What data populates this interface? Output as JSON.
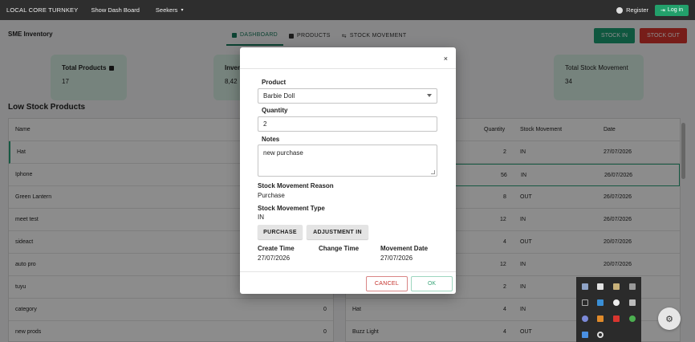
{
  "topbar": {
    "brand": "LOCAL CORE TURNKEY",
    "show_dash": "Show Dash Board",
    "seekers": "Seekers",
    "register": "Register",
    "login": "Log in"
  },
  "page": {
    "title": "SME Inventory",
    "tabs": [
      "DASHBOARD",
      "PRODUCTS",
      "STOCK MOVEMENT"
    ],
    "stock_in": "STOCK IN",
    "stock_out": "STOCK OUT",
    "cards": [
      {
        "label": "Total Products",
        "value": "17"
      },
      {
        "label": "Inven",
        "value": "8,42"
      },
      {
        "label": "Total Stock Movement",
        "value": "34"
      }
    ],
    "low_stock_title": "Low Stock Products",
    "left_table": {
      "header": "Name",
      "rows": [
        "Hat",
        "Iphone",
        "Green Lantern",
        "meet test",
        "sideact",
        "auto pro",
        "tuyu",
        "category",
        "new prods"
      ],
      "qty_tail": [
        "0",
        "0"
      ]
    },
    "right_table": {
      "headers": [
        "Quantity",
        "Stock Movement",
        "Date"
      ],
      "rows": [
        {
          "name": "",
          "qty": "2",
          "move": "IN",
          "date": "27/07/2026"
        },
        {
          "name": "",
          "qty": "56",
          "move": "IN",
          "date": "26/07/2026"
        },
        {
          "name": "",
          "qty": "8",
          "move": "OUT",
          "date": "26/07/2026"
        },
        {
          "name": "",
          "qty": "12",
          "move": "IN",
          "date": "26/07/2026"
        },
        {
          "name": "",
          "qty": "4",
          "move": "OUT",
          "date": "20/07/2026"
        },
        {
          "name": "",
          "qty": "12",
          "move": "IN",
          "date": "20/07/2026"
        },
        {
          "name": "",
          "qty": "2",
          "move": "IN",
          "date": ""
        },
        {
          "name": "Hat",
          "qty": "4",
          "move": "IN",
          "date": ""
        },
        {
          "name": "Buzz Light",
          "qty": "4",
          "move": "OUT",
          "date": ""
        }
      ]
    }
  },
  "modal": {
    "close": "×",
    "product_label": "Product",
    "product_value": "Barbie Doll",
    "quantity_label": "Quantity",
    "quantity_value": "2",
    "notes_label": "Notes",
    "notes_value": "new purchase",
    "reason_label": "Stock Movement Reason",
    "reason_value": "Purchase",
    "type_label": "Stock Movement Type",
    "type_value": "IN",
    "chip_purchase": "PURCHASE",
    "chip_adjust": "ADJUSTMENT IN",
    "create_time_label": "Create Time",
    "create_time_value": "27/07/2026",
    "change_time_label": "Change Time",
    "movement_date_label": "Movement Date",
    "movement_date_value": "27/07/2026",
    "cancel": "CANCEL",
    "ok": "OK"
  },
  "colors": {
    "accent": "#16785c",
    "danger": "#d9352f",
    "topbar": "#2e2e2e"
  }
}
